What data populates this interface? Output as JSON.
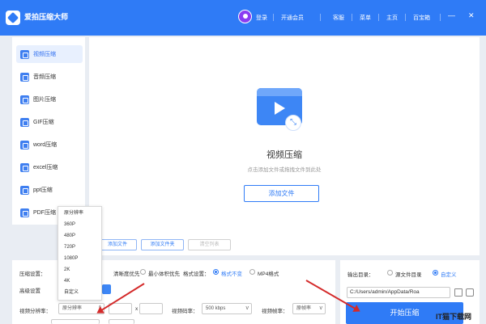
{
  "app": {
    "title": "爱拍压缩大师"
  },
  "titlebar": {
    "login": "登录",
    "vip": "开通会员",
    "service": "客服",
    "menu": "菜单",
    "home": "主页",
    "toolbox": "百宝箱",
    "minimize": "—",
    "close": "✕"
  },
  "sidebar": {
    "items": [
      {
        "label": "视频压缩",
        "active": true
      },
      {
        "label": "音频压缩",
        "active": false
      },
      {
        "label": "图片压缩",
        "active": false
      },
      {
        "label": "GIF压缩",
        "active": false
      },
      {
        "label": "word压缩",
        "active": false
      },
      {
        "label": "excel压缩",
        "active": false
      },
      {
        "label": "ppt压缩",
        "active": false
      },
      {
        "label": "PDF压缩",
        "active": false
      }
    ]
  },
  "main": {
    "title": "视频压缩",
    "hint": "点击添加文件或拖拽文件到此处",
    "add_file": "添加文件",
    "badge": "⤡",
    "buttons": {
      "add_file": "添加文件",
      "add_folder": "添加文件夹",
      "clear_list": "清空列表"
    }
  },
  "settings": {
    "compress_label": "压缩设置：",
    "clarity_first": "清晰度优先",
    "min_size_first": "最小体积优先",
    "format_label": "格式设置：",
    "format_keep": "格式不变",
    "format_mp4": "MP4格式",
    "advanced": "高级设置",
    "resolution_label": "视频分辨率：",
    "resolution_value": "原分辨率",
    "resolution_sep": "x",
    "bitrate_label": "视频码率：",
    "bitrate_value": "500 kbps",
    "framerate_label": "视频帧率：",
    "framerate_value": "原帧率"
  },
  "dropdown": {
    "options": [
      "原分辨率",
      "360P",
      "480P",
      "720P",
      "1080P",
      "2K",
      "4K",
      "自定义"
    ]
  },
  "output": {
    "label": "输出目录：",
    "source_dir": "源文件目录",
    "custom": "自定义",
    "path": "C:/Users/admin/AppData/Roa",
    "start": "开始压缩"
  },
  "watermark": "IT猫下载网",
  "colors": {
    "primary": "#2f7bf6",
    "arrow": "#d42a2a",
    "background": "#e9edf3"
  }
}
